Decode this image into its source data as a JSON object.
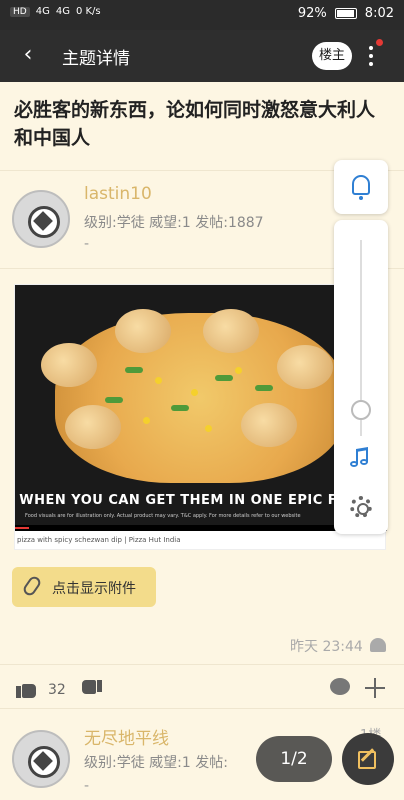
{
  "status_bar": {
    "left_labels": [
      "HD",
      "4G",
      "4G",
      "0 K/s"
    ],
    "battery": "92%",
    "time": "8:02",
    "battery_level": 0.92
  },
  "nav": {
    "back_icon": "back-icon",
    "title": "主题详情",
    "op_label": "楼主",
    "more_icon": "more-vertical-icon"
  },
  "post": {
    "title": "必胜客的新东西，论如何同时激怒意大利人和中国人",
    "author": {
      "name": "lastin10",
      "meta": "级别:学徒   威望:1   发帖:1887",
      "signature": "-"
    },
    "image": {
      "overlay_text": "WHEN YOU CAN GET THEM IN ONE EPIC FEAST!",
      "fine_print": "Food visuals are for illustration only. Actual product may vary. T&C apply. For more details refer to our website",
      "caption": "pizza with spicy schezwan dip | Pizza Hut India"
    },
    "attachment_label": "点击显示附件",
    "timestamp": "昨天 23:44",
    "likes": "32"
  },
  "reply": {
    "name": "无尽地平线",
    "meta": "级别:学徒   威望:1   发帖:",
    "floor": "1楼",
    "signature": "-"
  },
  "floating": {
    "page_indicator": "1/2"
  },
  "colors": {
    "accent": "#2f7fd3",
    "author_name": "#d9b66a",
    "background": "#fdf6e3",
    "navbar": "#2e2e2e"
  }
}
